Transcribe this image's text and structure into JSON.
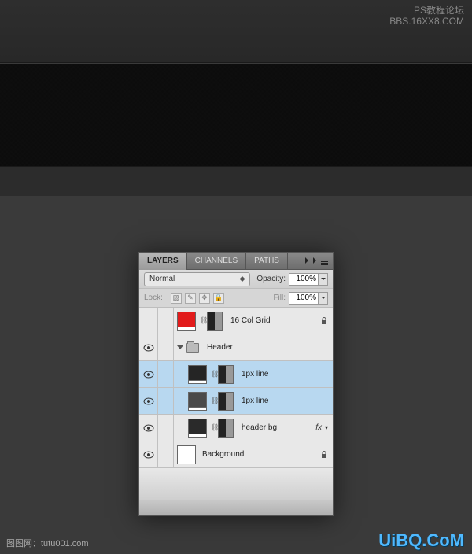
{
  "watermark": {
    "top_line1": "PS教程论坛",
    "top_line2": "BBS.16XX8.COM",
    "bottom_left": "图图网：tutu001.com",
    "bottom_right": "UiBQ.CoM"
  },
  "panel": {
    "tabs": [
      {
        "label": "LAYERS",
        "active": true
      },
      {
        "label": "CHANNELS",
        "active": false
      },
      {
        "label": "PATHS",
        "active": false
      }
    ],
    "blend_mode": "Normal",
    "opacity_label": "Opacity:",
    "opacity_value": "100%",
    "lock_label": "Lock:",
    "fill_label": "Fill:",
    "fill_value": "100%"
  },
  "layers": [
    {
      "type": "layer",
      "visible": false,
      "name": "16 Col Grid",
      "thumb_color": "#e21b1b",
      "has_mask": true,
      "selected": false,
      "locked": true
    },
    {
      "type": "group",
      "visible": true,
      "name": "Header",
      "selected": false
    },
    {
      "type": "layer",
      "visible": true,
      "name": "1px line",
      "thumb_color": "#252525",
      "has_mask": true,
      "selected": true,
      "indent": true
    },
    {
      "type": "layer",
      "visible": true,
      "name": "1px line",
      "thumb_color": "#4a4a4a",
      "has_mask": true,
      "selected": true,
      "indent": true
    },
    {
      "type": "layer",
      "visible": true,
      "name": "header bg",
      "thumb_color": "#2a2a2a",
      "has_mask": true,
      "selected": false,
      "indent": true,
      "fx": true
    },
    {
      "type": "bg",
      "visible": true,
      "name": "Background",
      "selected": false,
      "locked": true
    }
  ]
}
